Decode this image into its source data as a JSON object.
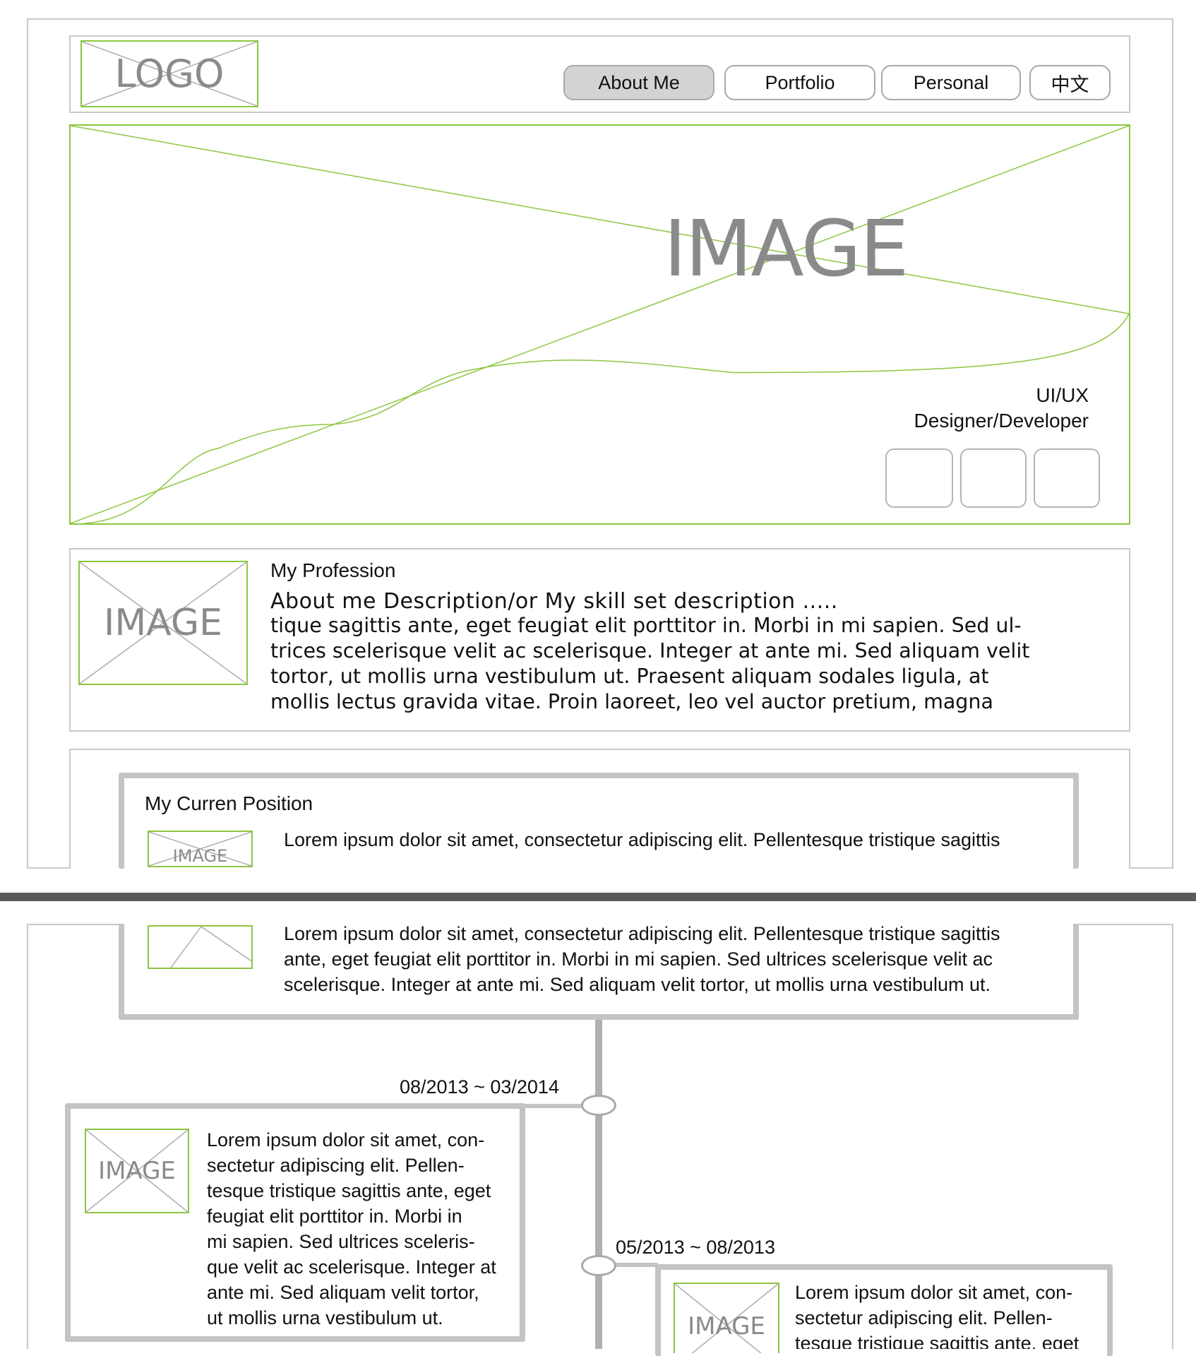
{
  "header": {
    "logo_text": "LOGO",
    "nav": [
      {
        "label": "About Me",
        "active": true
      },
      {
        "label": "Portfolio",
        "active": false
      },
      {
        "label": "Personal",
        "active": false
      },
      {
        "label": "中文",
        "active": false
      }
    ]
  },
  "hero": {
    "image_label": "IMAGE",
    "role_line1": "UI/UX",
    "role_line2": "Designer/Developer"
  },
  "profession": {
    "image_label": "IMAGE",
    "title": "My Profession",
    "description": "About me Description/or My skill set description .....",
    "lines": [
      "tique sagittis ante, eget feugiat elit porttitor in. Morbi in mi sapien. Sed ul-",
      "trices scelerisque velit ac scelerisque. Integer at ante mi. Sed aliquam velit",
      "tortor, ut mollis urna vestibulum ut. Praesent aliquam sodales ligula, at",
      "mollis lectus gravida vitae. Proin laoreet, leo vel auctor pretium, magna"
    ]
  },
  "position": {
    "title": "My Curren Position",
    "image_label": "IMAGE",
    "line_top": "Lorem ipsum dolor sit amet, consectetur adipiscing elit. Pellentesque tristique sagittis",
    "lines": [
      "Lorem ipsum dolor sit amet, consectetur adipiscing elit. Pellentesque tristique sagittis",
      "ante, eget feugiat elit porttitor in. Morbi in mi sapien. Sed ultrices scelerisque velit ac",
      "scelerisque. Integer at ante mi. Sed aliquam velit tortor, ut mollis urna vestibulum ut."
    ]
  },
  "timeline": [
    {
      "date": "08/2013 ~ 03/2014",
      "image_label": "IMAGE",
      "lines": [
        "Lorem ipsum dolor sit amet, con-",
        "sectetur adipiscing elit. Pellen-",
        "tesque tristique sagittis ante, eget",
        "feugiat elit porttitor in. Morbi in",
        "mi sapien. Sed ultrices sceleris-",
        "que velit ac scelerisque. Integer at",
        "ante mi. Sed aliquam velit tortor,",
        "ut mollis urna vestibulum ut."
      ]
    },
    {
      "date": "05/2013 ~ 08/2013",
      "image_label": "IMAGE",
      "lines": [
        "Lorem ipsum dolor sit amet, con-",
        "sectetur adipiscing elit. Pellen-",
        "tesque tristique sagittis ante, eget"
      ]
    }
  ],
  "colors": {
    "placeholder_border": "#8cc63f",
    "active_nav": "#d3d3d3",
    "frame_border": "#c9c9c9",
    "rough_border": "#c4c4c4"
  }
}
